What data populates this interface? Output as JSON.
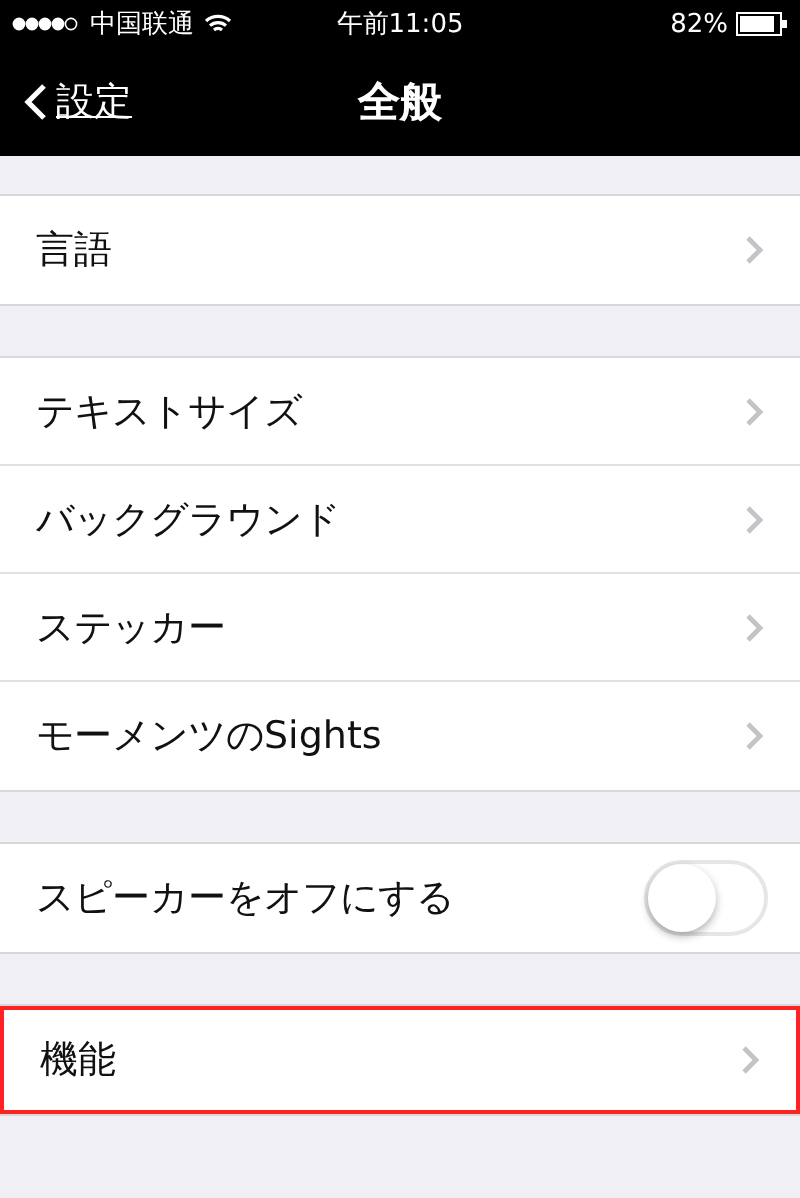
{
  "status_bar": {
    "carrier": "中国联通",
    "time": "午前11:05",
    "battery": "82%"
  },
  "nav": {
    "back": "設定",
    "title": "全般"
  },
  "sections": [
    {
      "rows": [
        {
          "kind": "link",
          "label": "言語",
          "highlighted": false
        }
      ]
    },
    {
      "rows": [
        {
          "kind": "link",
          "label": "テキストサイズ",
          "highlighted": false
        },
        {
          "kind": "link",
          "label": "バックグラウンド",
          "highlighted": false
        },
        {
          "kind": "link",
          "label": "ステッカー",
          "highlighted": false
        },
        {
          "kind": "link",
          "label": "モーメンツのSights",
          "highlighted": false
        }
      ]
    },
    {
      "rows": [
        {
          "kind": "toggle",
          "label": "スピーカーをオフにする",
          "on": false,
          "highlighted": false
        }
      ]
    },
    {
      "rows": [
        {
          "kind": "link",
          "label": "機能",
          "highlighted": true
        }
      ]
    }
  ]
}
